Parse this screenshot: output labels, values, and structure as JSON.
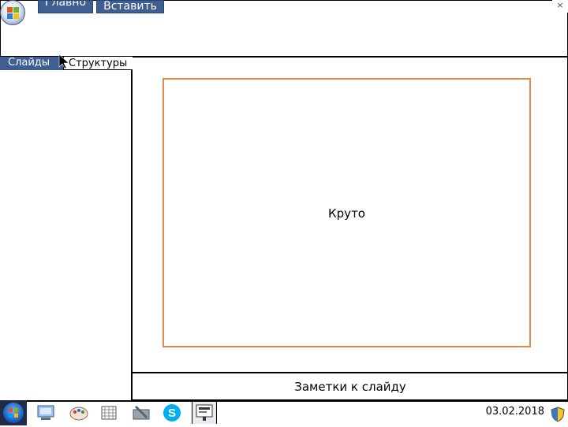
{
  "ribbon": {
    "tabs": [
      {
        "label": "Главно"
      },
      {
        "label": "Вставить"
      }
    ],
    "close_glyph": "×"
  },
  "left_pane": {
    "tabs": [
      {
        "label": "Слайды"
      },
      {
        "label": "Структуры"
      }
    ]
  },
  "slide": {
    "text": "Круто"
  },
  "notes": {
    "label": "Заметки к слайду"
  },
  "taskbar": {
    "apps": [
      {
        "icon": "explorer-icon"
      },
      {
        "icon": "paint-icon"
      },
      {
        "icon": "network-icon"
      },
      {
        "icon": "tools-icon"
      },
      {
        "icon": "skype-icon"
      },
      {
        "icon": "presentation-icon"
      }
    ],
    "date": "03.02.2018"
  },
  "colors": {
    "tab_blue": "#3f5f93",
    "slide_border": "#e08a45"
  }
}
